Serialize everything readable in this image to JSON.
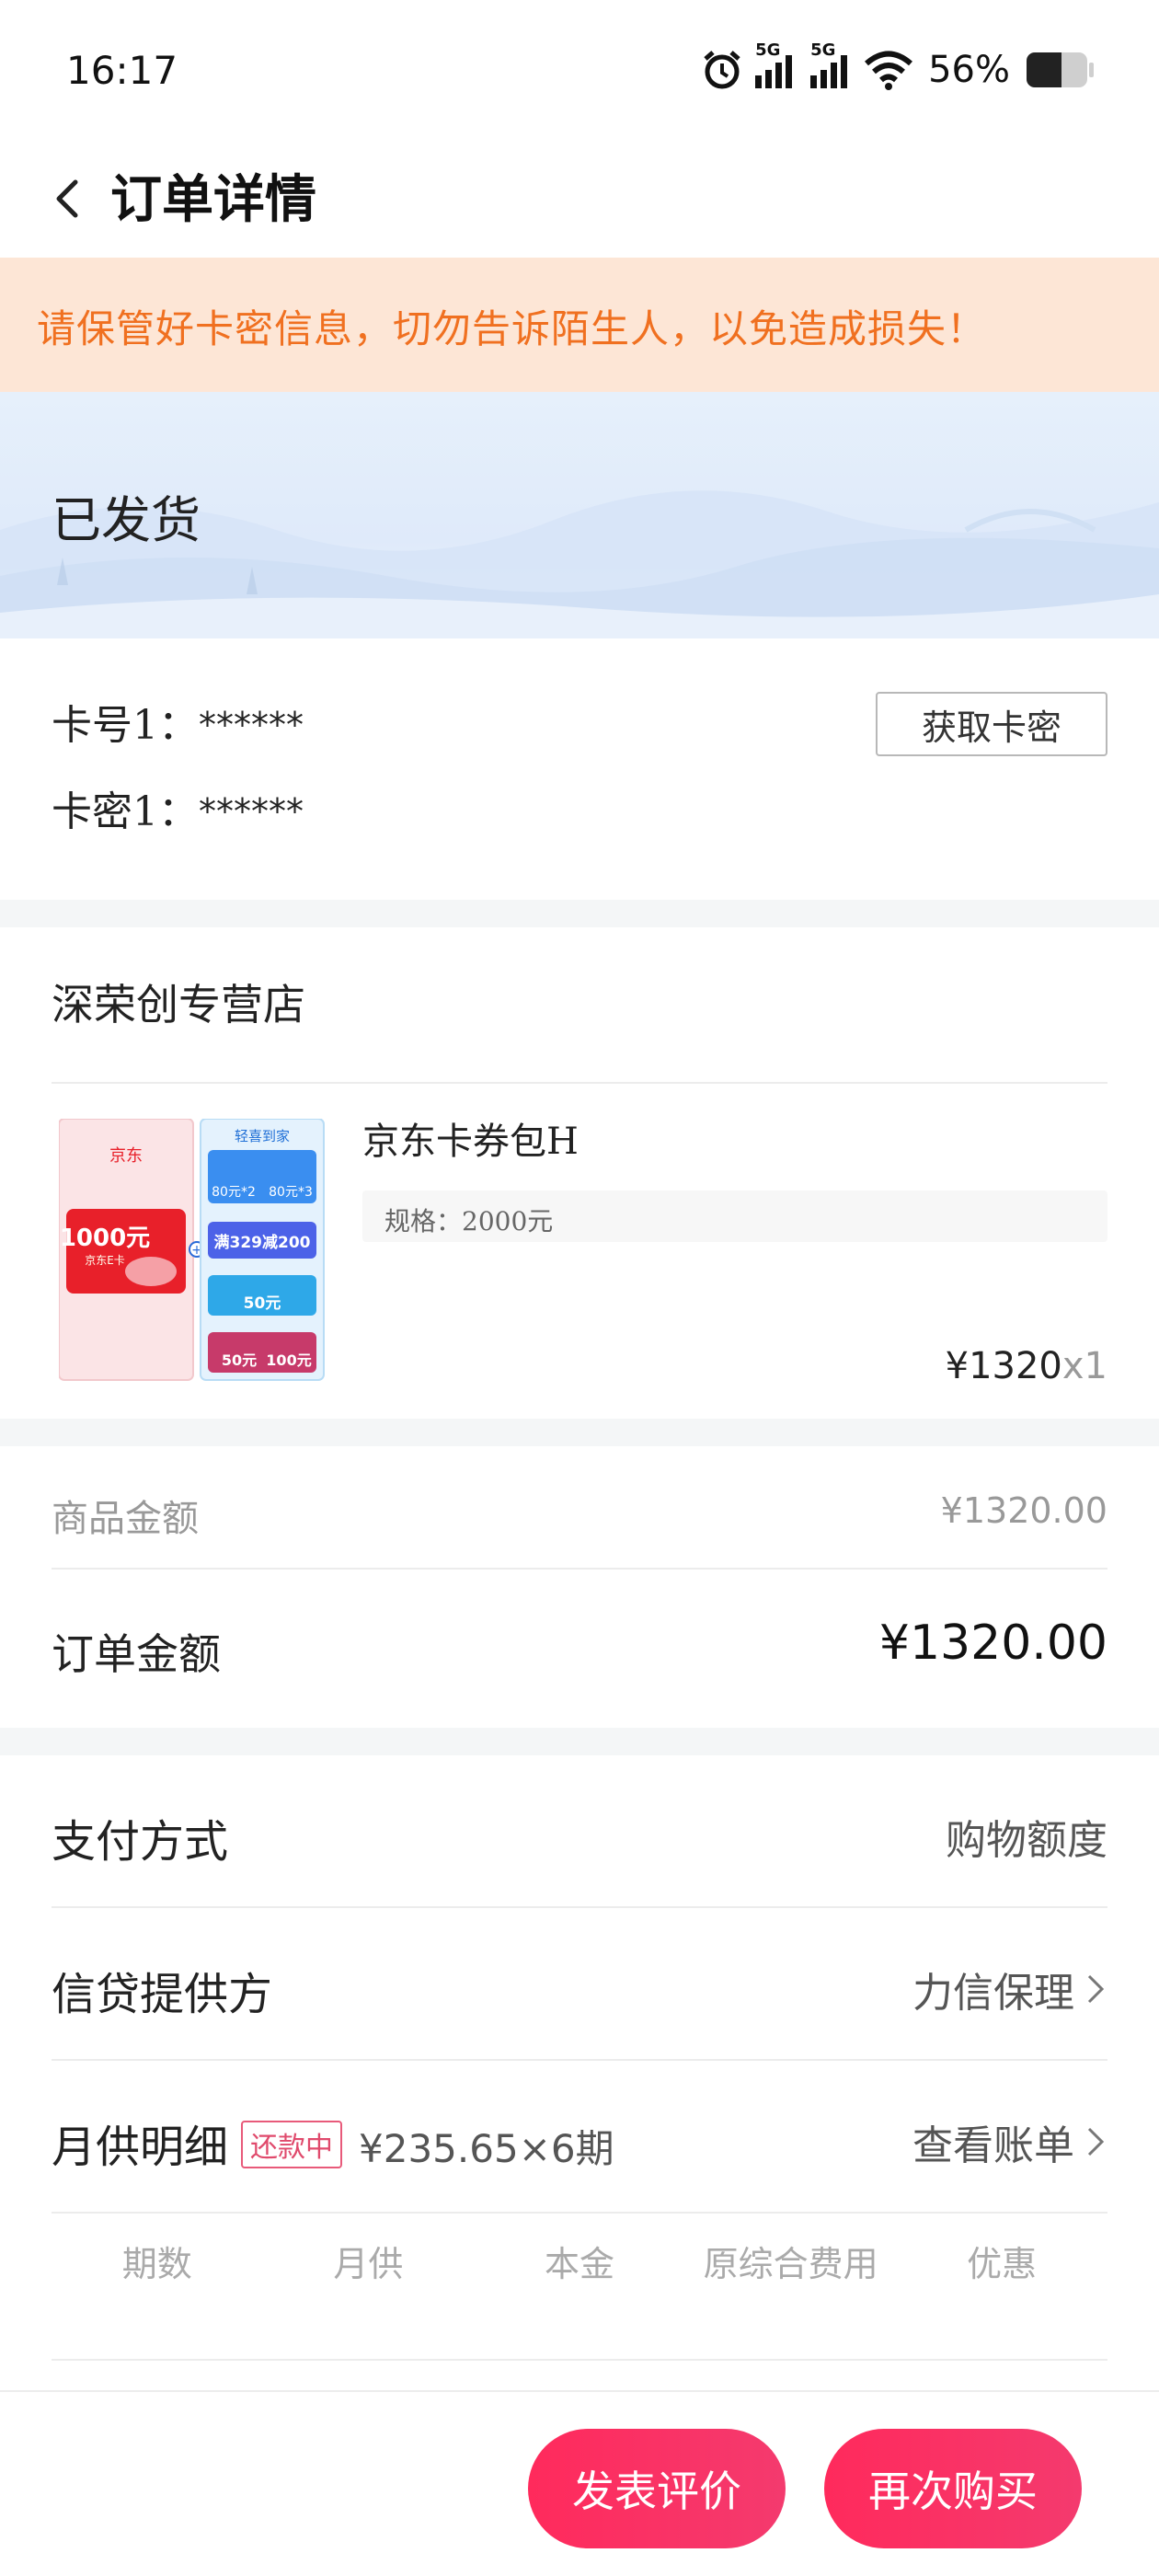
{
  "status_bar": {
    "time": "16:17",
    "network_1": "5G",
    "network_2": "5G",
    "battery": "56%",
    "icons": [
      "alarm-icon",
      "signal-icon",
      "signal-icon",
      "wifi-icon",
      "battery-icon"
    ]
  },
  "nav": {
    "back_icon": "chevron-left-icon",
    "title": "订单详情"
  },
  "warning": {
    "text": "请保管好卡密信息，切勿告诉陌生人，以免造成损失！",
    "color": "#f07020",
    "background": "#fde6d6"
  },
  "order_status": {
    "title": "已发货"
  },
  "card_info": {
    "card_number_label": "卡号1：",
    "card_number_value": "******",
    "card_secret_label": "卡密1：",
    "card_secret_value": "******",
    "get_secret_button": "获取卡密"
  },
  "store": {
    "name": "深荣创专营店",
    "product": {
      "name": "京东卡券包H",
      "spec": "规格：2000元",
      "price": "¥1320",
      "quantity": "x1",
      "thumbnail": {
        "card_brand": "京东",
        "card_value": "1000元",
        "card_sub": "京东E卡",
        "coupon_header": "轻喜到家",
        "coupons": [
          "80元*2",
          "80元*3",
          "满329减200",
          "50元",
          "50元",
          "100元"
        ]
      }
    }
  },
  "amounts": {
    "goods_label": "商品金额",
    "goods_value": "¥1320.00",
    "order_label": "订单金额",
    "order_value": "¥1320.00"
  },
  "payment": {
    "method_label": "支付方式",
    "method_value": "购物额度",
    "provider_label": "信贷提供方",
    "provider_value": "力信保理",
    "monthly_label": "月供明细",
    "monthly_badge": "还款中",
    "monthly_detail": "¥235.65×6期",
    "bill_link": "查看账单",
    "table_headers": [
      "期数",
      "月供",
      "本金",
      "原综合费用",
      "优惠"
    ]
  },
  "actions": {
    "review": "发表评价",
    "rebuy": "再次购买",
    "accent": "#ff2a5c"
  }
}
